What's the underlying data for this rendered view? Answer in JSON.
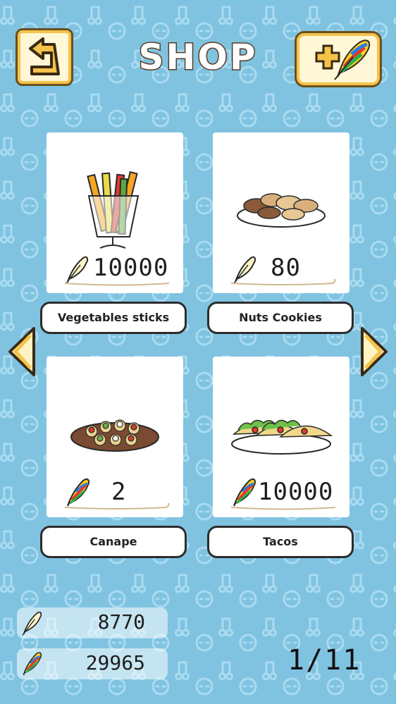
{
  "header": {
    "title": "SHOP"
  },
  "items": [
    {
      "name": "Vegetables sticks",
      "price": "10000",
      "currency": "normal-feather"
    },
    {
      "name": "Nuts Cookies",
      "price": "80",
      "currency": "normal-feather"
    },
    {
      "name": "Canape",
      "price": "2",
      "currency": "rainbow-feather"
    },
    {
      "name": "Tacos",
      "price": "10000",
      "currency": "rainbow-feather"
    }
  ],
  "wallet": {
    "normal_feathers": "8770",
    "rainbow_feathers": "29965"
  },
  "pagination": {
    "text": "1/11"
  },
  "colors": {
    "background": "#7fc3e1",
    "button_gold": "#f4c34a",
    "button_border": "#6a4f1f"
  }
}
